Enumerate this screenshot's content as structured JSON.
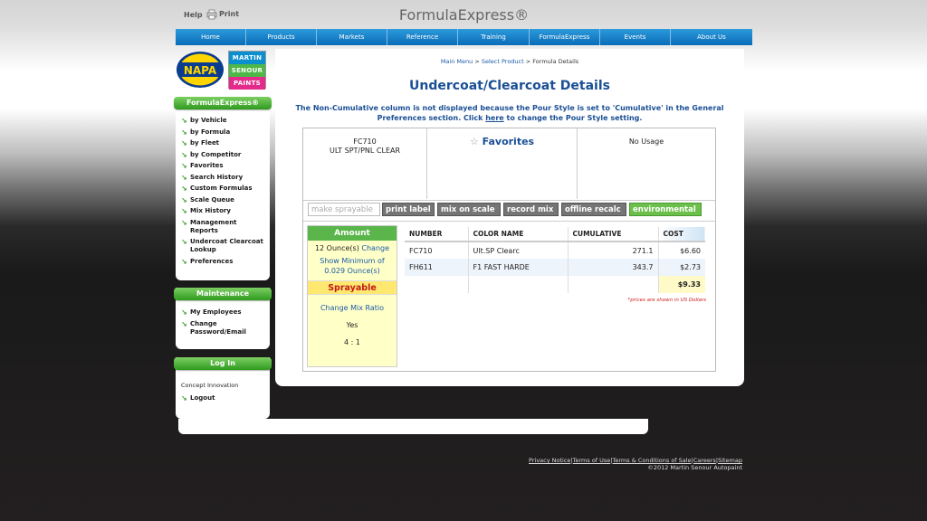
{
  "header": {
    "help_label": "Help",
    "print_label": "Print",
    "brand": "FormulaExpress®"
  },
  "nav": [
    "Home",
    "Products",
    "Markets",
    "Reference",
    "Training",
    "FormulaExpress",
    "Events",
    "About Us"
  ],
  "logos": {
    "napa": "NAPA",
    "msp": [
      "MARTIN",
      "SENOUR",
      "PAINTS"
    ]
  },
  "sidebar": {
    "formula_head": "FormulaExpress®",
    "formula_items": [
      "by Vehicle",
      "by Formula",
      "by Fleet",
      "by Competitor",
      "Favorites",
      "Search History",
      "Custom Formulas",
      "Scale Queue",
      "Mix History",
      "Management Reports",
      "Undercoat Clearcoat Lookup",
      "Preferences"
    ],
    "maint_head": "Maintenance",
    "maint_items": [
      "My Employees",
      "Change Password/Email"
    ],
    "login_head": "Log In",
    "login_company": "Concept Innovation",
    "logout_label": "Logout"
  },
  "breadcrumb": {
    "main_menu": "Main Menu",
    "sep": ">",
    "select_product": "Select Product",
    "current": "Formula Details"
  },
  "page": {
    "title": "Undercoat/Clearcoat Details",
    "notice_pre": "The Non-Cumulative column is not displayed because the Pour Style is set to 'Cumulative' in the General Preferences section. Click ",
    "notice_link": "here",
    "notice_post": " to change the Pour Style setting."
  },
  "formula": {
    "code": "FC710",
    "name": "ULT SPT/PNL CLEAR",
    "favorites_label": "Favorites",
    "usage": "No Usage"
  },
  "actions": [
    "make sprayable",
    "print label",
    "mix on scale",
    "record mix",
    "offline recalc",
    "environmental"
  ],
  "amount": {
    "head": "Amount",
    "qty": "12 Ounce(s)",
    "change": "Change",
    "show_min": "Show Minimum of 0.029 Ounce(s)",
    "spray_head": "Sprayable",
    "change_ratio": "Change Mix Ratio",
    "yes": "Yes",
    "ratio": "4 : 1"
  },
  "table": {
    "headers": [
      "NUMBER",
      "COLOR NAME",
      "CUMULATIVE",
      "COST"
    ],
    "rows": [
      [
        "FC710",
        "Ult.SP Clearc",
        "271.1",
        "$6.60"
      ],
      [
        "FH611",
        "F1 FAST HARDE",
        "343.7",
        "$2.73"
      ]
    ],
    "total": "$9.33",
    "note": "*prices are shown in US Dollars"
  },
  "footer": {
    "links": [
      "Privacy Notice",
      "Terms of Use",
      "Terms & Conditions of Sale",
      "Careers",
      "Sitemap"
    ],
    "copyright": "©2012 Martin Senour Autopaint"
  },
  "colors": {
    "nav": "#0a6cb8",
    "accent_green": "#2e9a1e",
    "title_blue": "#1a4f95"
  }
}
